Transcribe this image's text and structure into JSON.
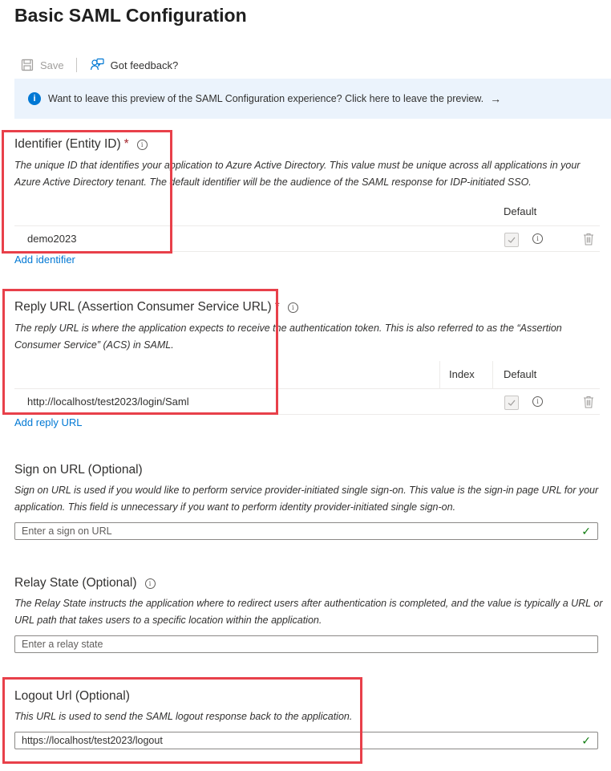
{
  "page": {
    "title": "Basic SAML Configuration"
  },
  "toolbar": {
    "save_label": "Save",
    "feedback_label": "Got feedback?"
  },
  "banner": {
    "text": "Want to leave this preview of the SAML Configuration experience? Click here to leave the preview.",
    "arrow": "→"
  },
  "identifier": {
    "title": "Identifier (Entity ID)",
    "required_mark": "*",
    "description": "The unique ID that identifies your application to Azure Active Directory. This value must be unique across all applications in your Azure Active Directory tenant. The default identifier will be the audience of the SAML response for IDP-initiated SSO.",
    "col_default": "Default",
    "rows": [
      {
        "value": "demo2023"
      }
    ],
    "add_link": "Add identifier"
  },
  "reply_url": {
    "title": "Reply URL (Assertion Consumer Service URL)",
    "required_mark": "*",
    "description": "The reply URL is where the application expects to receive the authentication token. This is also referred to as the “Assertion Consumer Service” (ACS) in SAML.",
    "col_index": "Index",
    "col_default": "Default",
    "rows": [
      {
        "value": "http://localhost/test2023/login/Saml"
      }
    ],
    "add_link": "Add reply URL"
  },
  "sign_on": {
    "title": "Sign on URL (Optional)",
    "description": "Sign on URL is used if you would like to perform service provider-initiated single sign-on. This value is the sign-in page URL for your application. This field is unnecessary if you want to perform identity provider-initiated single sign-on.",
    "placeholder": "Enter a sign on URL",
    "value": ""
  },
  "relay_state": {
    "title": "Relay State (Optional)",
    "description": "The Relay State instructs the application where to redirect users after authentication is completed, and the value is typically a URL or URL path that takes users to a specific location within the application.",
    "placeholder": "Enter a relay state",
    "value": ""
  },
  "logout": {
    "title": "Logout Url (Optional)",
    "description": "This URL is used to send the SAML logout response back to the application.",
    "value": "https://localhost/test2023/logout"
  },
  "colors": {
    "accent": "#0078d4",
    "highlight": "#e8404a",
    "success": "#107c10",
    "banner_bg": "#ebf3fc"
  },
  "icons": [
    "save-icon",
    "feedback-icon",
    "info-icon",
    "checkmark-icon",
    "trash-icon"
  ]
}
